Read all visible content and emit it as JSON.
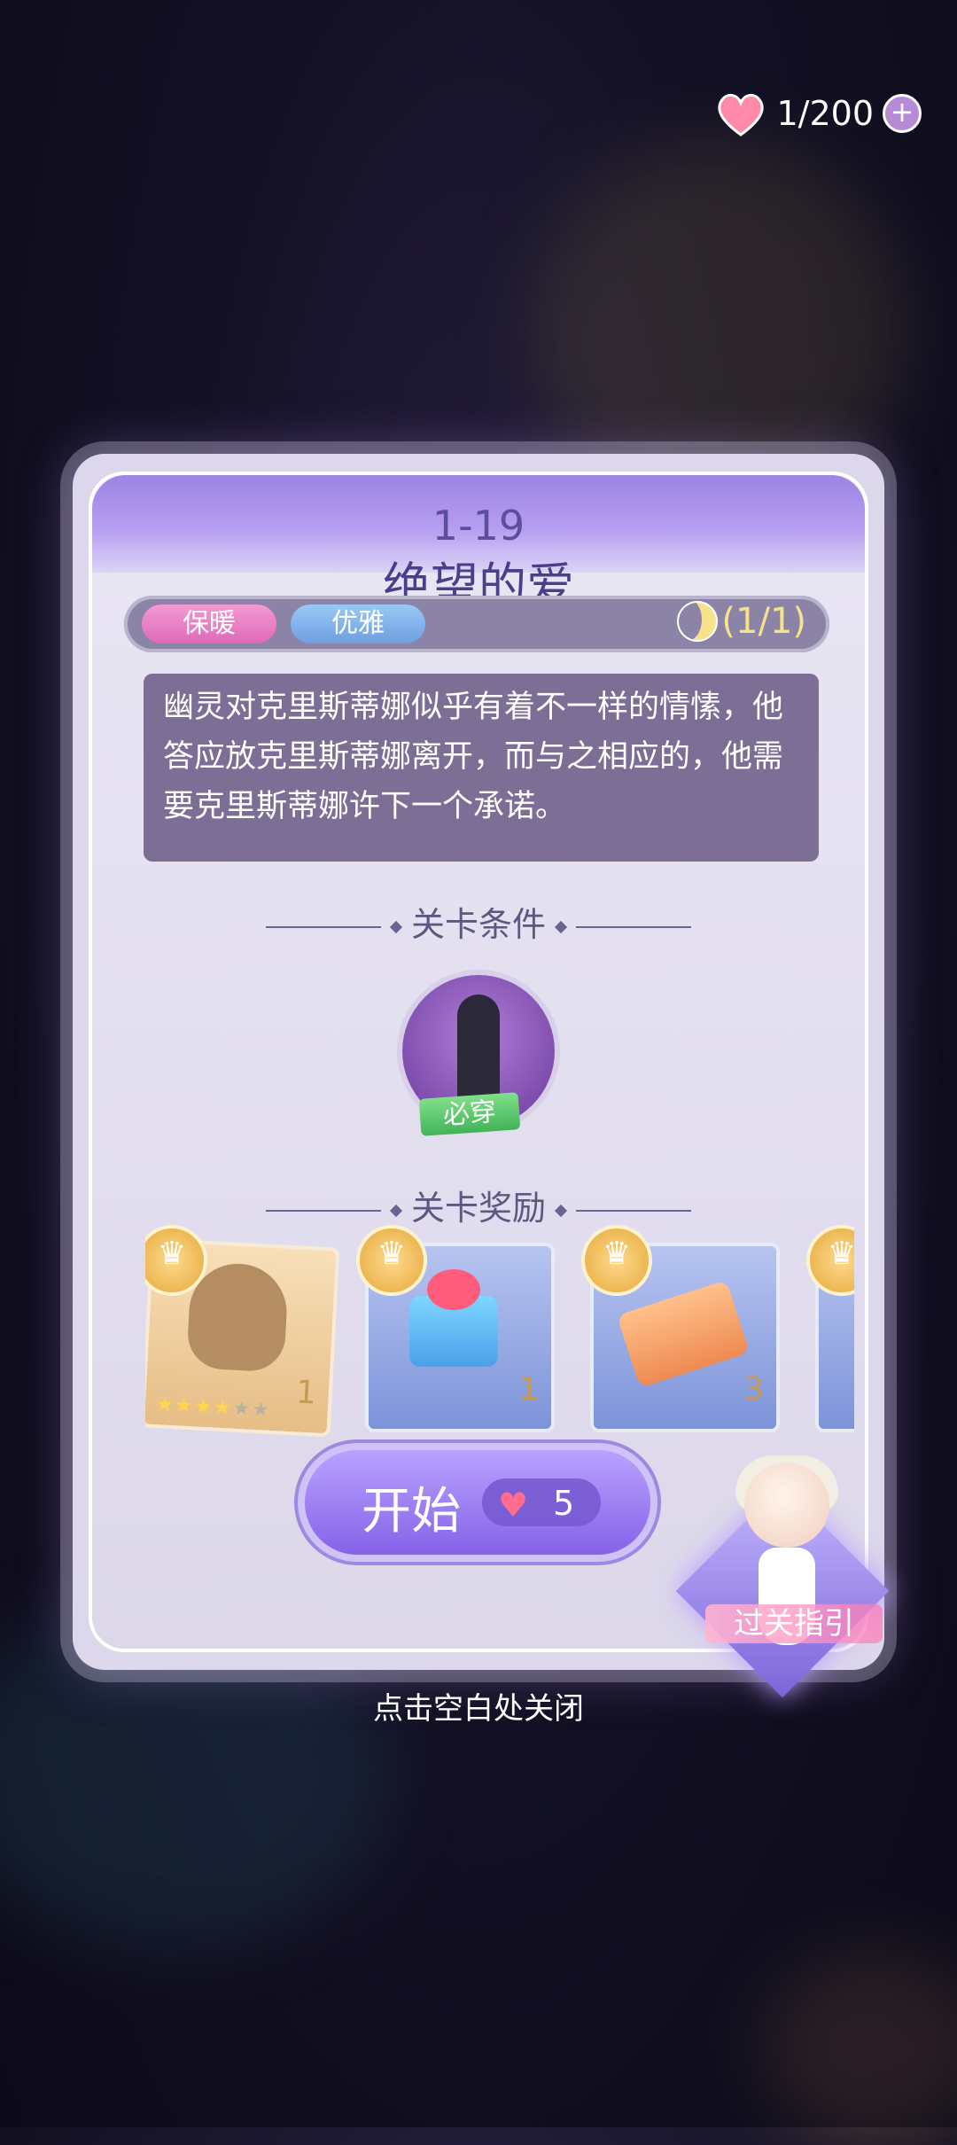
{
  "energy": {
    "text": "1/200"
  },
  "level": {
    "number": "1-19",
    "title": "绝望的爱",
    "tags": [
      "保暖",
      "优雅"
    ],
    "progress": "(1/1)",
    "story": "幽灵对克里斯蒂娜似乎有着不一样的情愫，他答应放克里斯蒂娜离开，而与之相应的，他需要克里斯蒂娜许下一个承诺。"
  },
  "requirement": {
    "title": "关卡条件",
    "badge": "必穿"
  },
  "rewards": {
    "title": "关卡奖励",
    "items": [
      {
        "count": "1",
        "stars": 4,
        "max_stars": 6
      },
      {
        "count": "1"
      },
      {
        "count": "3"
      }
    ]
  },
  "start": {
    "label": "开始",
    "cost": "5"
  },
  "guide": {
    "label": "过关指引"
  },
  "close_hint": "点击空白处关闭"
}
